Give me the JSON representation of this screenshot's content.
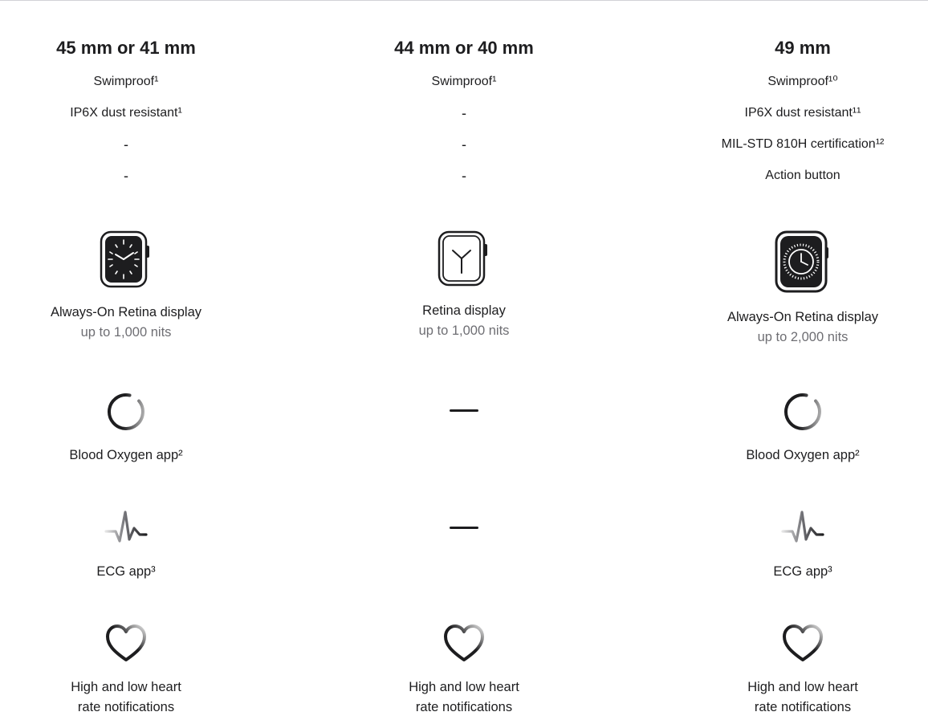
{
  "columns": [
    {
      "size": "45 mm or 41 mm",
      "specs": [
        "Swimproof¹",
        "IP6X dust resistant¹",
        "-",
        "-"
      ],
      "display_icon": "watch-face-dark-icon",
      "display_label": "Always-On Retina display",
      "display_sub": "up to 1,000 nits",
      "blood_oxygen": "Blood Oxygen app²",
      "ecg": "ECG app³",
      "heart_line1": "High and low heart",
      "heart_line2": "rate notifications"
    },
    {
      "size": "44 mm or 40 mm",
      "specs": [
        "Swimproof¹",
        "-",
        "-",
        "-"
      ],
      "display_icon": "watch-face-light-icon",
      "display_label": "Retina display",
      "display_sub": "up to 1,000 nits",
      "blood_oxygen": "—",
      "ecg": "—",
      "heart_line1": "High and low heart",
      "heart_line2": "rate notifications"
    },
    {
      "size": "49 mm",
      "specs": [
        "Swimproof¹⁰",
        "IP6X dust resistant¹¹",
        "MIL-STD 810H certification¹²",
        "Action button"
      ],
      "display_icon": "watch-ultra-face-icon",
      "display_label": "Always-On Retina display",
      "display_sub": "up to 2,000 nits",
      "blood_oxygen": "Blood Oxygen app²",
      "ecg": "ECG app³",
      "heart_line1": "High and low heart",
      "heart_line2": "rate notifications"
    }
  ],
  "colors": {
    "text": "#1d1d1f",
    "secondary": "#6e6e73",
    "divider": "#d2d2d7"
  }
}
